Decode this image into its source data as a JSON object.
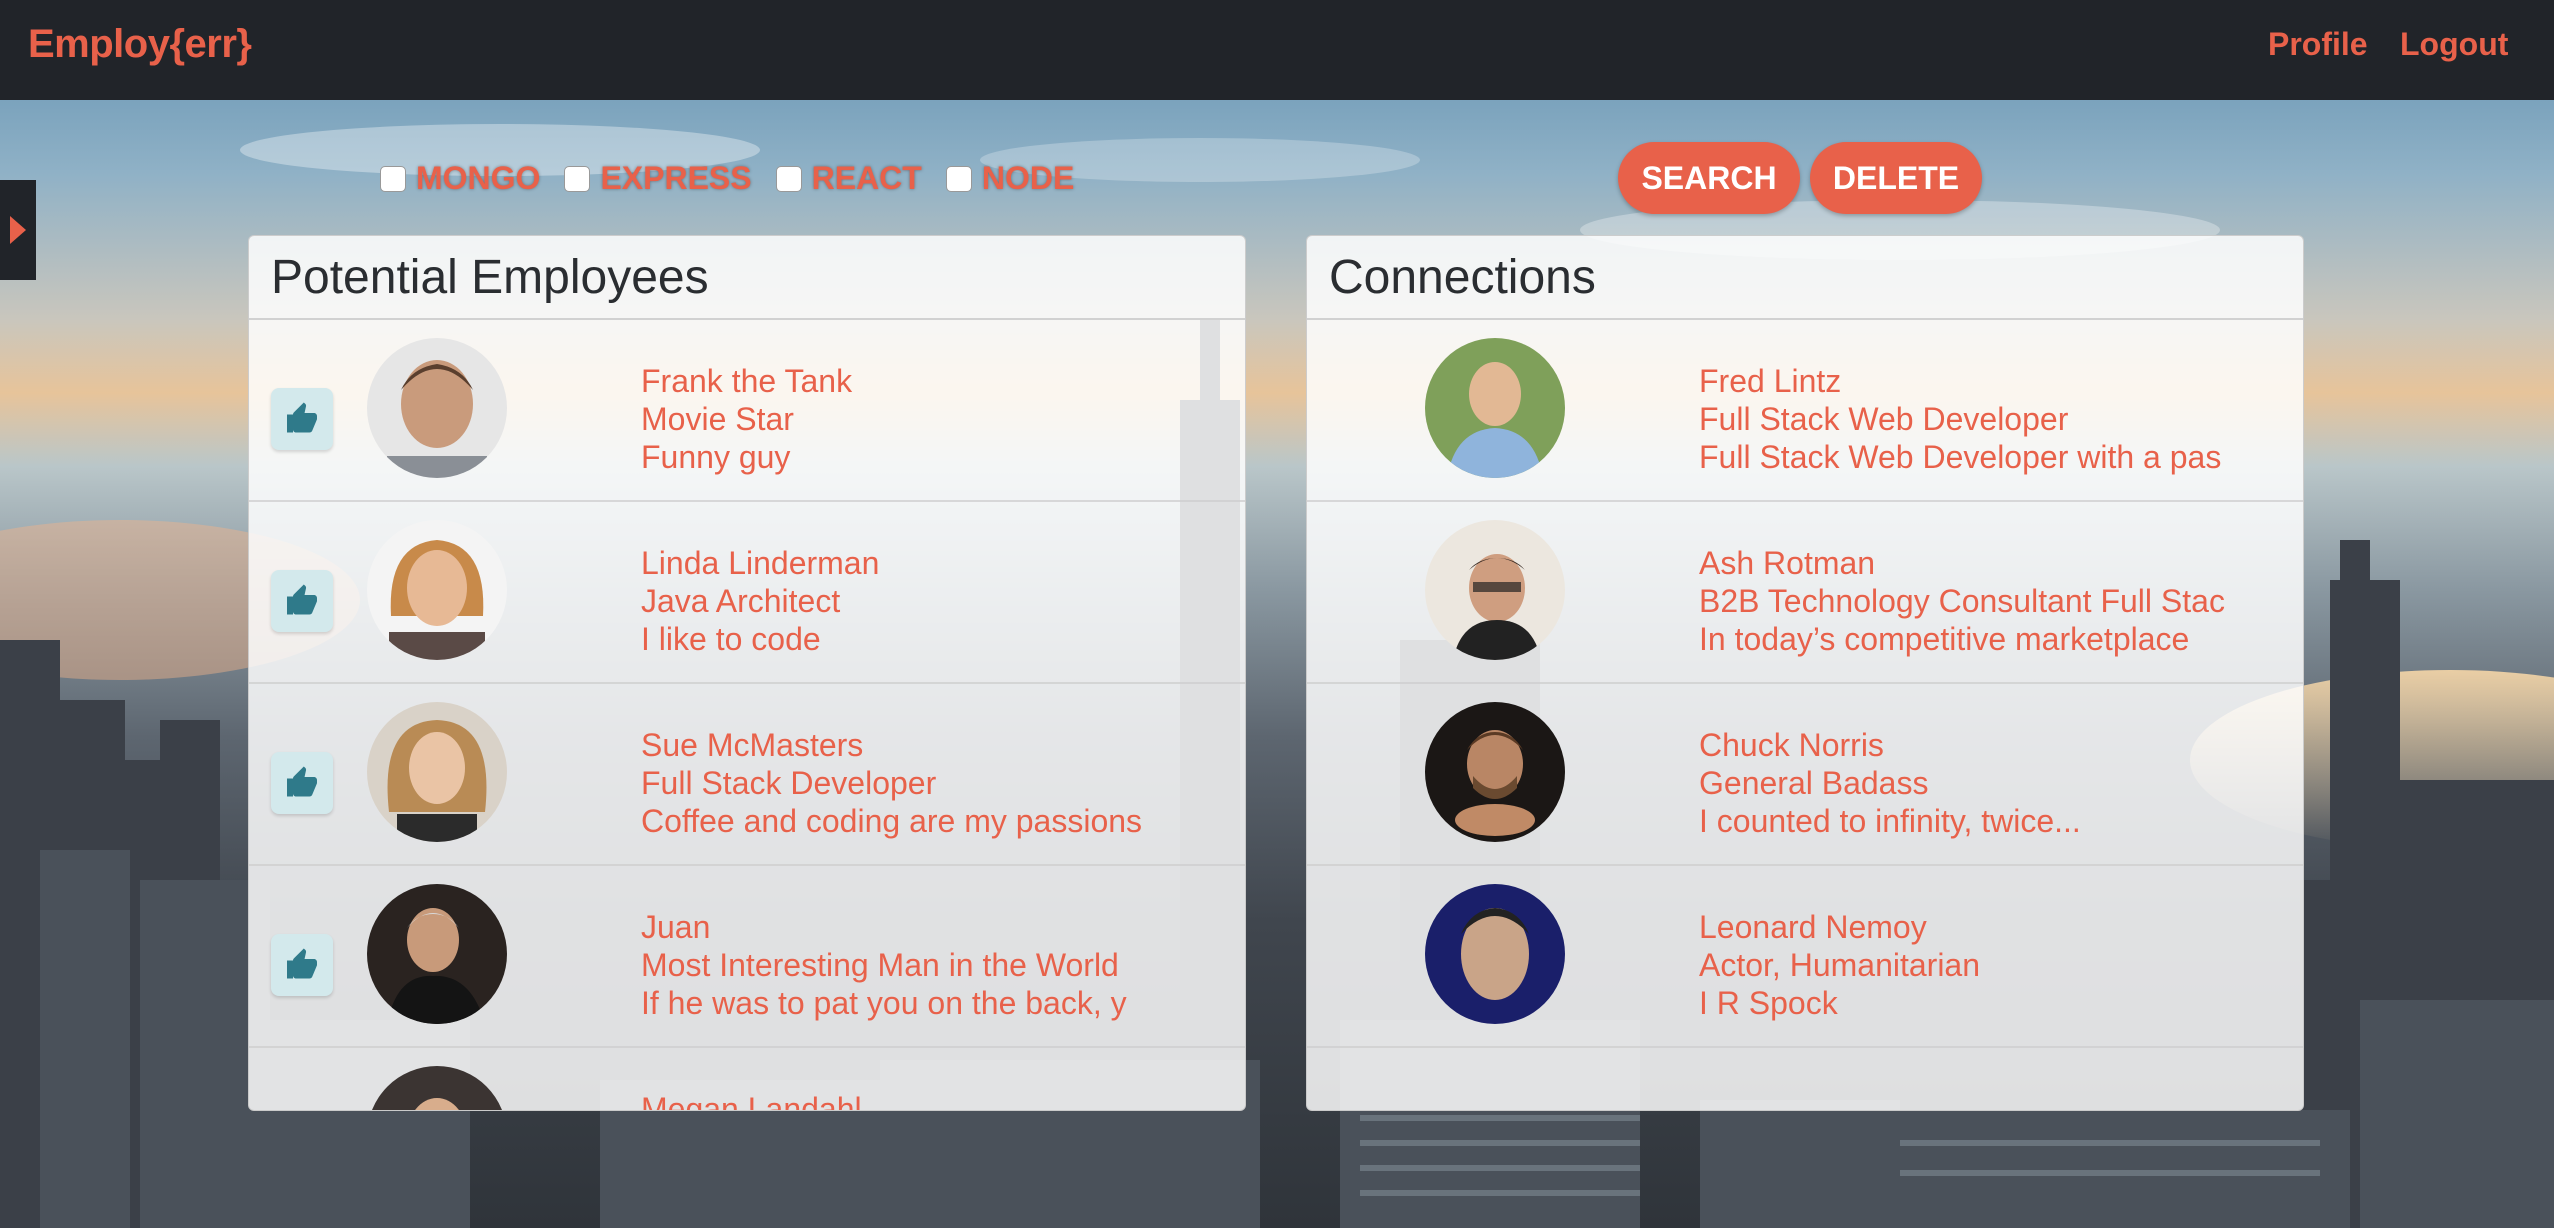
{
  "brand": "Employ{err}",
  "nav": {
    "profile": "Profile",
    "logout": "Logout"
  },
  "filters": [
    "MONGO",
    "EXPRESS",
    "REACT",
    "NODE"
  ],
  "buttons": {
    "search": "SEARCH",
    "delete": "DELETE"
  },
  "potential": {
    "title": "Potential Employees",
    "items": [
      {
        "name": "Frank the Tank",
        "role": "Movie Star",
        "bio": "Funny guy"
      },
      {
        "name": "Linda Linderman",
        "role": "Java Architect",
        "bio": "I like to code"
      },
      {
        "name": "Sue McMasters",
        "role": "Full Stack Developer",
        "bio": "Coffee and coding are my passions"
      },
      {
        "name": "Juan",
        "role": "Most Interesting Man in the World",
        "bio": "If he was to pat you on the back, y"
      },
      {
        "name": "Megan Landahl",
        "role": "",
        "bio": ""
      }
    ]
  },
  "connections": {
    "title": "Connections",
    "items": [
      {
        "name": "Fred Lintz",
        "role": "Full Stack Web Developer",
        "bio": "Full Stack Web Developer with a pas"
      },
      {
        "name": "Ash Rotman",
        "role": "B2B Technology Consultant Full Stac",
        "bio": "In today’s competitive marketplace"
      },
      {
        "name": "Chuck Norris",
        "role": "General Badass",
        "bio": "I counted to infinity, twice..."
      },
      {
        "name": "Leonard Nemoy",
        "role": "Actor, Humanitarian",
        "bio": "I R Spock"
      }
    ]
  },
  "icons": {
    "like": "thumbs-up-icon",
    "sidebar_toggle": "caret-right-icon"
  },
  "colors": {
    "accent": "#e8614a",
    "navbar": "#212429",
    "like_bg": "#d3e9ec",
    "like_icon": "#2f7a8a"
  }
}
